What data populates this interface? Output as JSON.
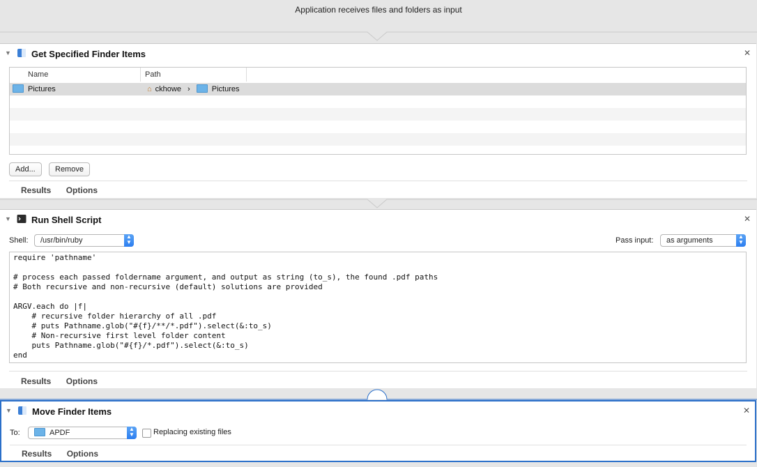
{
  "header": {
    "text": "Application receives files and folders as input"
  },
  "actions": {
    "get_items": {
      "title": "Get Specified Finder Items",
      "columns": [
        "Name",
        "Path"
      ],
      "rows": [
        {
          "name": "Pictures",
          "path_parts": [
            "ckhowe",
            "›",
            "Pictures"
          ]
        }
      ],
      "add_label": "Add...",
      "remove_label": "Remove",
      "tabs": [
        "Results",
        "Options"
      ]
    },
    "shell": {
      "title": "Run Shell Script",
      "shell_label": "Shell:",
      "shell_value": "/usr/bin/ruby",
      "pass_input_label": "Pass input:",
      "pass_input_value": "as arguments",
      "script": "require 'pathname'\n\n# process each passed foldername argument, and output as string (to_s), the found .pdf paths\n# Both recursive and non-recursive (default) solutions are provided\n\nARGV.each do |f|\n    # recursive folder hierarchy of all .pdf\n    # puts Pathname.glob(\"#{f}/**/*.pdf\").select(&:to_s)\n    # Non-recursive first level folder content\n    puts Pathname.glob(\"#{f}/*.pdf\").select(&:to_s)\nend",
      "tabs": [
        "Results",
        "Options"
      ]
    },
    "move": {
      "title": "Move Finder Items",
      "to_label": "To:",
      "to_value": "APDF",
      "replace_label": "Replacing existing files",
      "replace_checked": false,
      "tabs": [
        "Results",
        "Options"
      ]
    }
  },
  "colors": {
    "selection_border": "#2a6fc9",
    "accent": "#2c7ef0"
  }
}
